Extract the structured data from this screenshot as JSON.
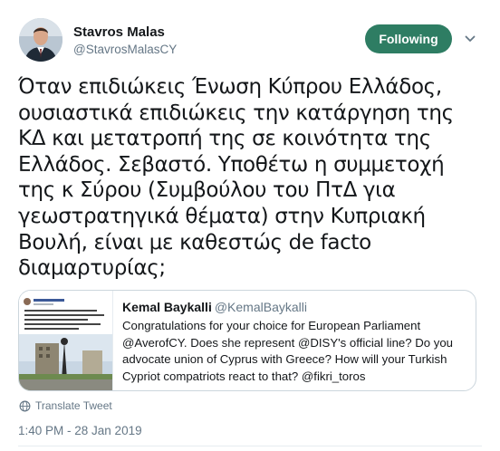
{
  "author": {
    "display_name": "Stavros Malas",
    "handle": "@StavrosMalasCY",
    "avatar": "avatar-photo"
  },
  "follow_button": {
    "label": "Following",
    "color": "#2e7d63"
  },
  "more_menu": {
    "icon": "chevron-down-icon"
  },
  "tweet": {
    "lines": [
      "Όταν επιδιώκεις Ένωση Κύπρου Ελλάδος,",
      "ουσιαστικά επιδιώκεις την κατάργηση της",
      "ΚΔ και μετατροπή της σε κοινότητα της",
      "Ελλάδος. Σεβαστό. Υποθέτω η συμμετοχή",
      "της κ Σύρου (Συμβούλου του ΠτΔ για",
      "γεωστρατηγικά θέματα) στην Κυπριακή",
      "Βουλή, είναι με καθεστώς de facto",
      "διαμαρτυρίας;"
    ]
  },
  "quoted_tweet": {
    "display_name": "Kemal Baykalli",
    "handle": "@KemalBaykalli",
    "lines": [
      "Congratulations for your choice for European Parliament",
      "@AverofCY. Does she represent @DISY's official line? Do you",
      "advocate union of Cyprus with Greece? How will your Turkish",
      "Cypriot compatriots react to that? @fikri_toros"
    ],
    "media": "screenshot-thumbnail"
  },
  "translate": {
    "label": "Translate Tweet",
    "icon": "globe-icon"
  },
  "timestamp": "1:40 PM - 28 Jan 2019"
}
